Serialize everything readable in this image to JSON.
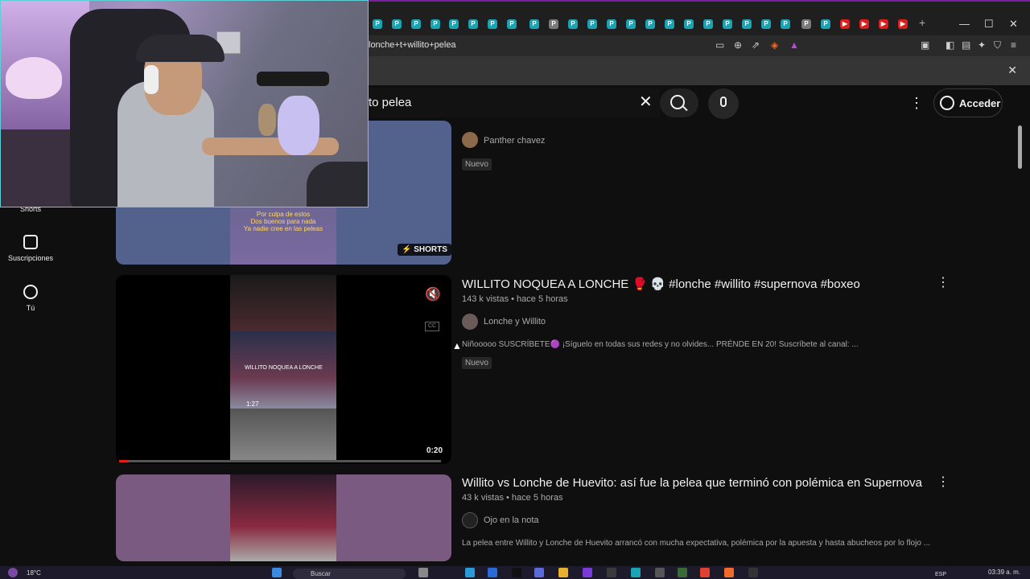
{
  "browser": {
    "url": "lonche+t+willito+pelea",
    "window_controls": {
      "minimize": "—",
      "maximize": "☐",
      "close": "✕",
      "new_tab": "+"
    }
  },
  "youtube": {
    "search_query": "to pelea",
    "signin_label": "Acceder",
    "sidebar": [
      {
        "label": "Shorts"
      },
      {
        "label": "Suscripciones"
      },
      {
        "label": "Tú"
      }
    ]
  },
  "results": [
    {
      "channel": "Panther chavez",
      "badge": "Nuevo",
      "thumb_caption_1": "Por culpa de estos",
      "thumb_caption_2": "Dos buenos para nada",
      "thumb_caption_3": "Ya nadie cree en las peleas",
      "shorts_label": "SHORTS"
    },
    {
      "title": "WILLITO NOQUEA A LONCHE 🥊 💀 #lonche #willito #supernova #boxeo",
      "meta": "143 k vistas • hace 5 horas",
      "channel": "Lonche y Willito",
      "description": "Niñooooo SUSCRÍBETE🟣 ¡Síguelo en todas sus redes y no olvides... PRÉNDE EN 20! Suscríbete al canal: ...",
      "badge": "Nuevo",
      "inner_caption": "WILLITO NOQUEA A LONCHE",
      "inner_time": "1:27",
      "duration": "0:20"
    },
    {
      "title": "Willito vs Lonche de Huevito: así fue la pelea que terminó con polémica en Supernova",
      "meta": "43 k vistas • hace 5 horas",
      "channel": "Ojo en la nota",
      "description": "La pelea entre Willito y Lonche de Huevito arrancó con mucha expectativa, polémica por la apuesta y hasta abucheos por lo flojo ..."
    }
  ],
  "taskbar": {
    "weather": "18°C",
    "search": "Buscar",
    "lang": "ESP",
    "clock": "03:39 a. m."
  },
  "colors": {
    "background": "#0f0f0f",
    "accent_tab": "#1aa3b3",
    "youtube_red": "#e01d1d"
  }
}
